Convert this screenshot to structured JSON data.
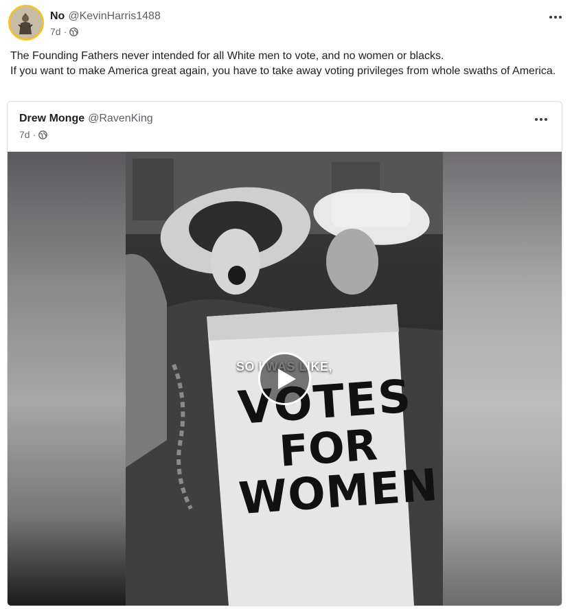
{
  "post": {
    "author_name": "No",
    "author_handle": "@KevinHarris1488",
    "time": "7d",
    "separator": "·",
    "more_icon": "more-horizontal-icon",
    "visibility_icon": "globe-icon",
    "text_lines": [
      "The Founding Fathers never intended for all White men to vote, and no women or blacks.",
      "If you want to make America great again, you have to take away voting privileges from whole swaths of America."
    ]
  },
  "quoted_post": {
    "author_name": "Drew Monge",
    "author_handle": "@RavenKing",
    "time": "7d",
    "separator": "·",
    "more_icon": "more-horizontal-icon",
    "visibility_icon": "globe-icon",
    "video": {
      "caption": "SO I WAS LIKE,",
      "sign_text": [
        "VOTES",
        "FOR",
        "WOMEN"
      ],
      "play_icon": "play-icon"
    }
  }
}
